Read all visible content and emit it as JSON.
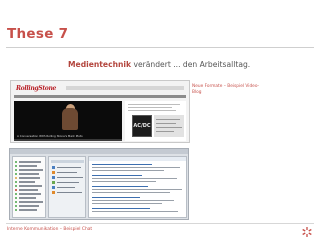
{
  "slide": {
    "title": "These 7",
    "headline_accent": "Medientechnik",
    "headline_rest": " verändert ... den Arbeitsalltag.",
    "caption_video": "Neue Formate – Beispiel Video-Blog",
    "caption_chat": "Interne Kommunikation – Beispiel Chat"
  },
  "video_shot": {
    "logo": "RollingStone",
    "player_caption": "A Conversation With Rolling Stone's Mark Pluto",
    "ad_label": "AC/DC"
  },
  "colors": {
    "accent": "#c7504a",
    "logo_red": "#b81f26",
    "online_green": "#47a447"
  }
}
